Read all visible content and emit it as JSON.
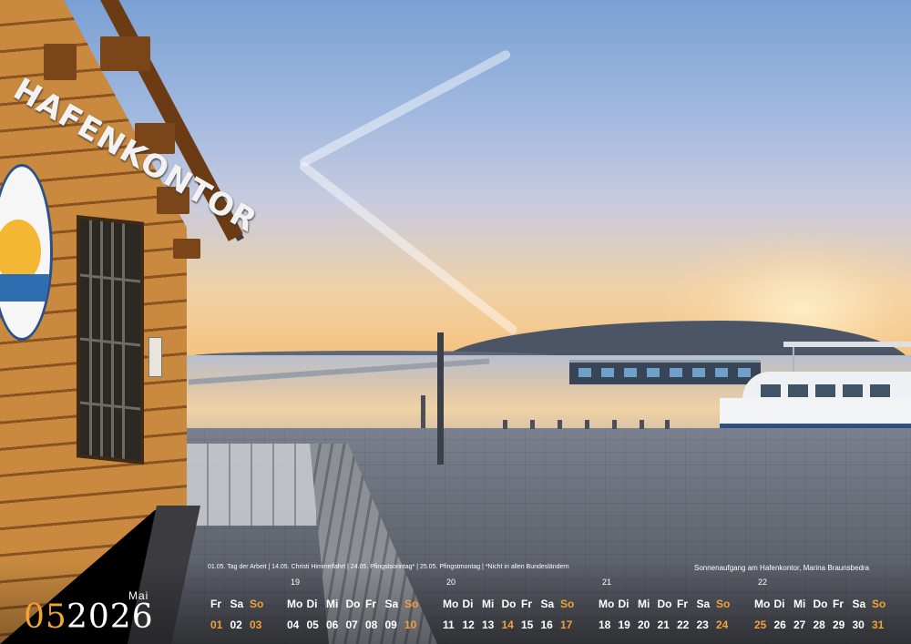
{
  "building_sign": "HAFENKONTOR",
  "calendar": {
    "month_number": "05",
    "year": "2026",
    "month_name": "Mai",
    "holidays_note": "01.05. Tag der Arbeit  |  14.05. Christi Himmelfahrt  |  24.05. Pfingstsonntag*  |  25.05. Pfingstmontag  |  *Nicht in allen Bundesländern",
    "photo_caption": "Sonnenaufgang am Hafenkontor, Marina Braunsbedra",
    "weeks": [
      {
        "week_number": "",
        "days": [
          {
            "wd": "Fr",
            "d": "01",
            "hl": true
          },
          {
            "wd": "Sa",
            "d": "02",
            "hl": false
          },
          {
            "wd": "So",
            "d": "03",
            "hl": true
          }
        ]
      },
      {
        "week_number": "19",
        "days": [
          {
            "wd": "Mo",
            "d": "04",
            "hl": false
          },
          {
            "wd": "Di",
            "d": "05",
            "hl": false
          },
          {
            "wd": "Mi",
            "d": "06",
            "hl": false
          },
          {
            "wd": "Do",
            "d": "07",
            "hl": false
          },
          {
            "wd": "Fr",
            "d": "08",
            "hl": false
          },
          {
            "wd": "Sa",
            "d": "09",
            "hl": false
          },
          {
            "wd": "So",
            "d": "10",
            "hl": true
          }
        ]
      },
      {
        "week_number": "20",
        "days": [
          {
            "wd": "Mo",
            "d": "11",
            "hl": false
          },
          {
            "wd": "Di",
            "d": "12",
            "hl": false
          },
          {
            "wd": "Mi",
            "d": "13",
            "hl": false
          },
          {
            "wd": "Do",
            "d": "14",
            "hl": true
          },
          {
            "wd": "Fr",
            "d": "15",
            "hl": false
          },
          {
            "wd": "Sa",
            "d": "16",
            "hl": false
          },
          {
            "wd": "So",
            "d": "17",
            "hl": true
          }
        ]
      },
      {
        "week_number": "21",
        "days": [
          {
            "wd": "Mo",
            "d": "18",
            "hl": false
          },
          {
            "wd": "Di",
            "d": "19",
            "hl": false
          },
          {
            "wd": "Mi",
            "d": "20",
            "hl": false
          },
          {
            "wd": "Do",
            "d": "21",
            "hl": false
          },
          {
            "wd": "Fr",
            "d": "22",
            "hl": false
          },
          {
            "wd": "Sa",
            "d": "23",
            "hl": false
          },
          {
            "wd": "So",
            "d": "24",
            "hl": true
          }
        ]
      },
      {
        "week_number": "22",
        "days": [
          {
            "wd": "Mo",
            "d": "25",
            "hl": true
          },
          {
            "wd": "Di",
            "d": "26",
            "hl": false
          },
          {
            "wd": "Mi",
            "d": "27",
            "hl": false
          },
          {
            "wd": "Do",
            "d": "28",
            "hl": false
          },
          {
            "wd": "Fr",
            "d": "29",
            "hl": false
          },
          {
            "wd": "Sa",
            "d": "30",
            "hl": false
          },
          {
            "wd": "So",
            "d": "31",
            "hl": true
          }
        ]
      }
    ]
  },
  "colors": {
    "accent": "#f0a23a",
    "text": "#ffffff"
  }
}
